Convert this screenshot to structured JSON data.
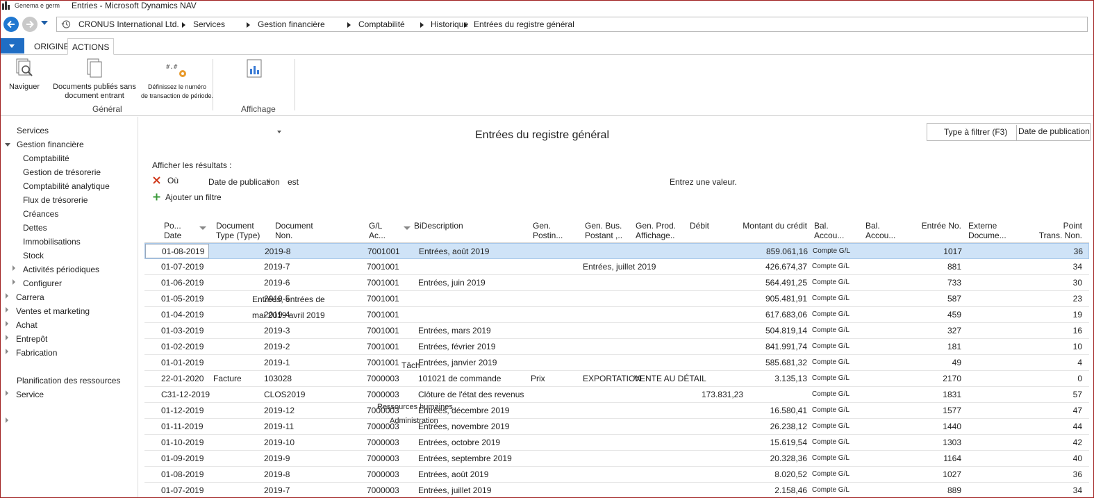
{
  "window": {
    "company_short": "Genema e germ",
    "title": "Entries - Microsoft Dynamics NAV"
  },
  "breadcrumb": {
    "company": "CRONUS International Ltd.",
    "items": [
      "Services",
      "Gestion financière",
      "Comptabilité",
      "Historique",
      "Entrées du registre général"
    ]
  },
  "ribbon": {
    "tabs": [
      "ORIGINE",
      "ACTIONS"
    ],
    "active_tab": "ACTIONS",
    "buttons": {
      "navigate": "Naviguer",
      "posted_docs_line1": "Documents publiés sans",
      "posted_docs_line2": "document entrant",
      "define_txn_line1": "Définissez le numéro",
      "define_txn_line2": "de transaction de période."
    },
    "groups": {
      "general": "Général",
      "display": "Affichage"
    }
  },
  "nav": {
    "root": "Services",
    "finance": "Gestion financière",
    "finance_children": [
      "Comptabilité",
      "Gestion de trésorerie",
      "Comptabilité analytique",
      "Flux de trésorerie",
      "Créances",
      "Dettes",
      "Immobilisations",
      "Stock",
      "Activités périodiques",
      "Configurer"
    ],
    "top_items": [
      "Carrera",
      "Ventes et marketing",
      "Achat",
      "Entrepôt",
      "Fabrication"
    ],
    "resource_planning": "Planification des ressources",
    "service": "Service"
  },
  "page": {
    "title": "Entrées du registre général",
    "search_placeholder": "Type à filtrer (F3)",
    "search_field": "Date de publication"
  },
  "filter": {
    "label": "Afficher les résultats :",
    "where": "Où",
    "field": "Date de publication",
    "operator": "est",
    "value_placeholder": "Entrez une valeur.",
    "add": "Ajouter un filtre"
  },
  "columns": {
    "posting_date": [
      "Po...",
      "Date"
    ],
    "doc_type": [
      "Document",
      "Type (Type)"
    ],
    "doc_no": [
      "Document",
      "Non."
    ],
    "gl_acc": [
      "G/L",
      "Ac..."
    ],
    "description": "BiDescription",
    "gen_posting": [
      "Gen.",
      "Postin..."
    ],
    "gen_bus": [
      "Gen. Bus.",
      "Postant ,.."
    ],
    "gen_prod": [
      "Gen. Prod.",
      "Affichage.."
    ],
    "debit": "Débit",
    "credit": "Montant du crédit",
    "bal_acc1": [
      "Bal.",
      "Accou..."
    ],
    "bal_acc2": [
      "Bal.",
      "Accou..."
    ],
    "entry_no": "Entrée No.",
    "ext_doc": [
      "Externe",
      "Docume..."
    ],
    "txn_no": [
      "Point",
      "Trans. Non."
    ]
  },
  "rows": [
    {
      "date": "01-08-2019",
      "type": "",
      "doc": "2019-8",
      "acc": "7001001",
      "desc": "Entrées, août 2019",
      "post": "",
      "bus": "",
      "prod": "",
      "debit": "",
      "credit": "859.061,16",
      "bal": "Compte G/L",
      "entry": "1017",
      "txn": "36"
    },
    {
      "date": "01-07-2019",
      "type": "",
      "doc": "2019-7",
      "acc": "7001001",
      "desc": "",
      "post": "",
      "bus": "Entrées, juillet 2019",
      "prod": "",
      "debit": "",
      "credit": "426.674,37",
      "bal": "Compte G/L",
      "entry": "881",
      "txn": "34"
    },
    {
      "date": "01-06-2019",
      "type": "",
      "doc": "2019-6",
      "acc": "7001001",
      "desc": "Entrées, juin 2019",
      "post": "",
      "bus": "",
      "prod": "",
      "debit": "",
      "credit": "564.491,25",
      "bal": "Compte G/L",
      "entry": "733",
      "txn": "30"
    },
    {
      "date": "01-05-2019",
      "type": "",
      "doc": "2019-5",
      "acc": "7001001",
      "desc": "",
      "post": "",
      "bus": "",
      "prod": "",
      "debit": "",
      "credit": "905.481,91",
      "bal": "Compte G/L",
      "entry": "587",
      "txn": "23"
    },
    {
      "date": "01-04-2019",
      "type": "",
      "doc": "2019-4",
      "acc": "7001001",
      "desc": "",
      "post": "",
      "bus": "",
      "prod": "",
      "debit": "",
      "credit": "617.683,06",
      "bal": "Compte G/L",
      "entry": "459",
      "txn": "19"
    },
    {
      "date": "01-03-2019",
      "type": "",
      "doc": "2019-3",
      "acc": "7001001",
      "desc": "Entrées, mars 2019",
      "post": "",
      "bus": "",
      "prod": "",
      "debit": "",
      "credit": "504.819,14",
      "bal": "Compte G/L",
      "entry": "327",
      "txn": "16"
    },
    {
      "date": "01-02-2019",
      "type": "",
      "doc": "2019-2",
      "acc": "7001001",
      "desc": "Entrées, février 2019",
      "post": "",
      "bus": "",
      "prod": "",
      "debit": "",
      "credit": "841.991,74",
      "bal": "Compte G/L",
      "entry": "181",
      "txn": "10"
    },
    {
      "date": "01-01-2019",
      "type": "",
      "doc": "2019-1",
      "acc": "7001001",
      "desc": "Entrées, janvier 2019",
      "post": "",
      "bus": "",
      "prod": "",
      "debit": "",
      "credit": "585.681,32",
      "bal": "Compte G/L",
      "entry": "49",
      "txn": "4"
    },
    {
      "date": "22-01-2020",
      "type": "Facture",
      "doc": "103028",
      "acc": "7000003",
      "desc": "101021 de commande",
      "post": "Prix",
      "bus": "EXPORTATION",
      "prod": "VENTE AU DÉTAIL",
      "debit": "",
      "credit": "3.135,13",
      "bal": "Compte G/L",
      "entry": "2170",
      "txn": "0"
    },
    {
      "date": "C31-12-2019",
      "type": "",
      "doc": "CLOS2019",
      "acc": "7000003",
      "desc": "Clôture de l'état des revenus",
      "post": "",
      "bus": "",
      "prod": "",
      "debit": "173.831,23",
      "credit": "",
      "bal": "Compte G/L",
      "entry": "1831",
      "txn": "57"
    },
    {
      "date": "01-12-2019",
      "type": "",
      "doc": "2019-12",
      "acc": "7000003",
      "desc": "Entrées, décembre 2019",
      "post": "",
      "bus": "",
      "prod": "",
      "debit": "",
      "credit": "16.580,41",
      "bal": "Compte G/L",
      "entry": "1577",
      "txn": "47"
    },
    {
      "date": "01-11-2019",
      "type": "",
      "doc": "2019-11",
      "acc": "7000003",
      "desc": "Entrées, novembre 2019",
      "post": "",
      "bus": "",
      "prod": "",
      "debit": "",
      "credit": "26.238,12",
      "bal": "Compte G/L",
      "entry": "1440",
      "txn": "44"
    },
    {
      "date": "01-10-2019",
      "type": "",
      "doc": "2019-10",
      "acc": "7000003",
      "desc": "Entrées, octobre 2019",
      "post": "",
      "bus": "",
      "prod": "",
      "debit": "",
      "credit": "15.619,54",
      "bal": "Compte G/L",
      "entry": "1303",
      "txn": "42"
    },
    {
      "date": "01-09-2019",
      "type": "",
      "doc": "2019-9",
      "acc": "7000003",
      "desc": "Entrées, septembre 2019",
      "post": "",
      "bus": "",
      "prod": "",
      "debit": "",
      "credit": "20.328,36",
      "bal": "Compte G/L",
      "entry": "1164",
      "txn": "40"
    },
    {
      "date": "01-08-2019",
      "type": "",
      "doc": "2019-8",
      "acc": "7000003",
      "desc": "Entrées, août 2019",
      "post": "",
      "bus": "",
      "prod": "",
      "debit": "",
      "credit": "8.020,52",
      "bal": "Compte G/L",
      "entry": "1027",
      "txn": "36"
    },
    {
      "date": "01-07-2019",
      "type": "",
      "doc": "2019-7",
      "acc": "7000003",
      "desc": "Entrées, juillet 2019",
      "post": "",
      "bus": "",
      "prod": "",
      "debit": "",
      "credit": "2.158,46",
      "bal": "Compte G/L",
      "entry": "889",
      "txn": "34"
    }
  ],
  "overlay": {
    "entries_line1": "Entrées, entrées de",
    "entries_line2": "mai 2019 avril 2019",
    "tasks": "Tâch",
    "resources": "Ressources humaines",
    "administration": "Administration"
  }
}
